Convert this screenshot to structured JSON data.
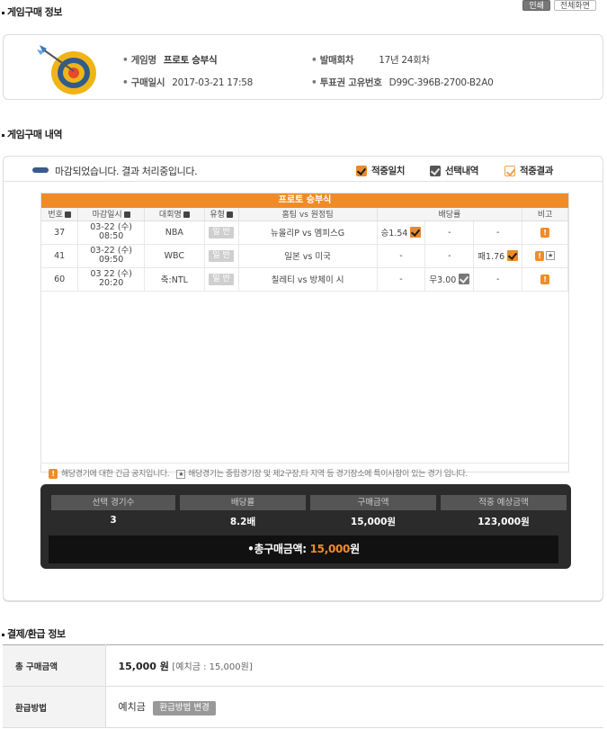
{
  "section_info": {
    "title": "게임구매 정보"
  },
  "top_buttons": {
    "left": "인쇄",
    "right": "전체화면"
  },
  "game_info": {
    "game_name_label": "게임명",
    "game_name_value": "프로토 승부식",
    "purchase_datetime_label": "구매일시",
    "purchase_datetime_value": "2017-03-21 17:58",
    "round_label": "발매회차",
    "round_value": "17년 24회차",
    "ticket_id_label": "투표권 고유번호",
    "ticket_id_value": "D99C-396B-2700-B2A0"
  },
  "section_detail": {
    "title": "게임구매 내역"
  },
  "status": {
    "text": "마감되었습니다. 결과 처리중입니다."
  },
  "legend": {
    "hit": "적중일치",
    "selection": "선택내역",
    "result": "적중결과"
  },
  "grid": {
    "title": "프로토 승부식",
    "headers": [
      "번호",
      "마감일시",
      "대회명",
      "유형",
      "홈팀 vs 원정팀",
      "배당률",
      "비고"
    ],
    "rows": [
      {
        "no": "37",
        "date": "03-22 (수)",
        "time": "08:50",
        "league": "NBA",
        "type": "일 반",
        "match": "뉴올리P vs 멤피스G",
        "odds1": "승1.54",
        "odds2": "-",
        "odds3": "-",
        "note": "!"
      },
      {
        "no": "41",
        "date": "03-22 (수)",
        "time": "09:50",
        "league": "WBC",
        "type": "일 반",
        "match": "일본 vs 미국",
        "odds1": "-",
        "odds2": "-",
        "odds3": "패1.76",
        "note": "!"
      },
      {
        "no": "60",
        "date": "03 22 (수)",
        "time": "20:20",
        "league": "축:NTL",
        "type": "일 반",
        "match": "칠레티 vs 방체이 시",
        "odds1": "-",
        "odds2": "무3.00",
        "odds3": "-",
        "note": "!"
      }
    ]
  },
  "notice": {
    "warn_text": "해당경기에 대한 긴급 공지입니다.",
    "star_text": "해당경기는 중립경기장 및 제2구장,타 지역 등 경기장소에 특이사항이 있는 경기 입니다."
  },
  "summary": {
    "headers": [
      "선택 경기수",
      "배당률",
      "구매금액",
      "적중 예상금액"
    ],
    "values": [
      "3",
      "8.2배",
      "15,000원",
      "123,000원"
    ],
    "total_label": "•총구매금액:",
    "total_amount": "15,000",
    "total_unit": "원"
  },
  "section_payment": {
    "title": "결제/환급 정보"
  },
  "payment": {
    "total_label": "총 구매금액",
    "total_amount": "15,000 원",
    "total_detail": "[예치금 : 15,000원]",
    "refund_label": "환급방법",
    "refund_value": "예치금",
    "refund_button": "환급방법 변경"
  },
  "colors": {
    "accent": "#f08c28",
    "dark": "#2b2b2b",
    "status_pill": "#3a5a8c"
  },
  "icons": {
    "game": "target-dart-icon",
    "warn": "exclamation-icon",
    "star": "star-icon"
  }
}
